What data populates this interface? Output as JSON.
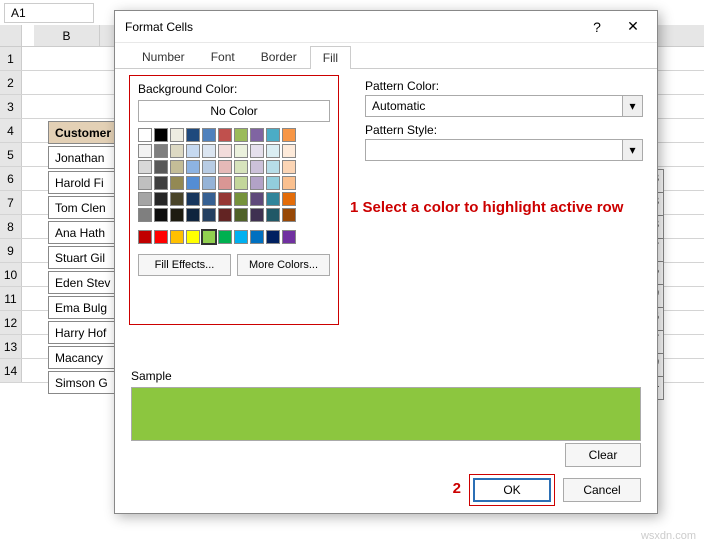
{
  "namebox": "A1",
  "col_b_label": "B",
  "sheet": {
    "row_numbers": [
      "1",
      "2",
      "3",
      "4",
      "5",
      "6",
      "7",
      "8",
      "9",
      "10",
      "11",
      "12",
      "13",
      "14"
    ],
    "table_header": "Customer",
    "customers": [
      "Jonathan",
      "Harold Fi",
      "Tom Clen",
      "Ana Hath",
      "Stuart Gil",
      "Eden Stev",
      "Ema Bulg",
      "Harry Hof",
      "Macancy",
      "Simson G"
    ],
    "right_values": [
      "23",
      "48",
      "38",
      "27",
      "25",
      "29",
      "26",
      "27",
      "19",
      "24"
    ]
  },
  "dialog": {
    "title": "Format Cells",
    "help_tip": "?",
    "close_tip": "✕",
    "tabs": {
      "number": "Number",
      "font": "Font",
      "border": "Border",
      "fill": "Fill"
    },
    "bg_label": "Background Color:",
    "no_color": "No Color",
    "fill_effects": "Fill Effects...",
    "more_colors": "More Colors...",
    "pattern_color_label": "Pattern Color:",
    "pattern_color_value": "Automatic",
    "pattern_style_label": "Pattern Style:",
    "pattern_style_value": "",
    "sample_label": "Sample",
    "clear": "Clear",
    "ok": "OK",
    "cancel": "Cancel"
  },
  "annotations": {
    "step1": "1 Select a color to highlight active row",
    "step2": "2"
  },
  "watermark": "wsxdn.com",
  "colors": {
    "theme": [
      "#ffffff",
      "#000000",
      "#eeece1",
      "#1f497d",
      "#4f81bd",
      "#c0504d",
      "#9bbb59",
      "#8064a2",
      "#4bacc6",
      "#f79646",
      "#f2f2f2",
      "#7f7f7f",
      "#ddd9c3",
      "#c6d9f0",
      "#dbe5f1",
      "#f2dcdb",
      "#ebf1dd",
      "#e5e0ec",
      "#dbeef3",
      "#fdeada",
      "#d8d8d8",
      "#595959",
      "#c4bd97",
      "#8db3e2",
      "#b8cce4",
      "#e5b9b7",
      "#d7e3bc",
      "#ccc1d9",
      "#b7dde8",
      "#fbd5b5",
      "#bfbfbf",
      "#3f3f3f",
      "#938953",
      "#548dd4",
      "#95b3d7",
      "#d99694",
      "#c3d69b",
      "#b2a2c7",
      "#92cddc",
      "#fac08f",
      "#a5a5a5",
      "#262626",
      "#494429",
      "#17365d",
      "#366092",
      "#953734",
      "#76923c",
      "#5f497a",
      "#31859b",
      "#e36c09",
      "#7f7f7f",
      "#0c0c0c",
      "#1d1b10",
      "#0f243e",
      "#244061",
      "#632423",
      "#4f6128",
      "#3f3151",
      "#205867",
      "#974806"
    ],
    "standard": [
      "#c00000",
      "#ff0000",
      "#ffc000",
      "#ffff00",
      "#92d050",
      "#00b050",
      "#00b0f0",
      "#0070c0",
      "#002060",
      "#7030a0"
    ],
    "selected_index": 4,
    "sample_fill": "#8cc63f"
  }
}
